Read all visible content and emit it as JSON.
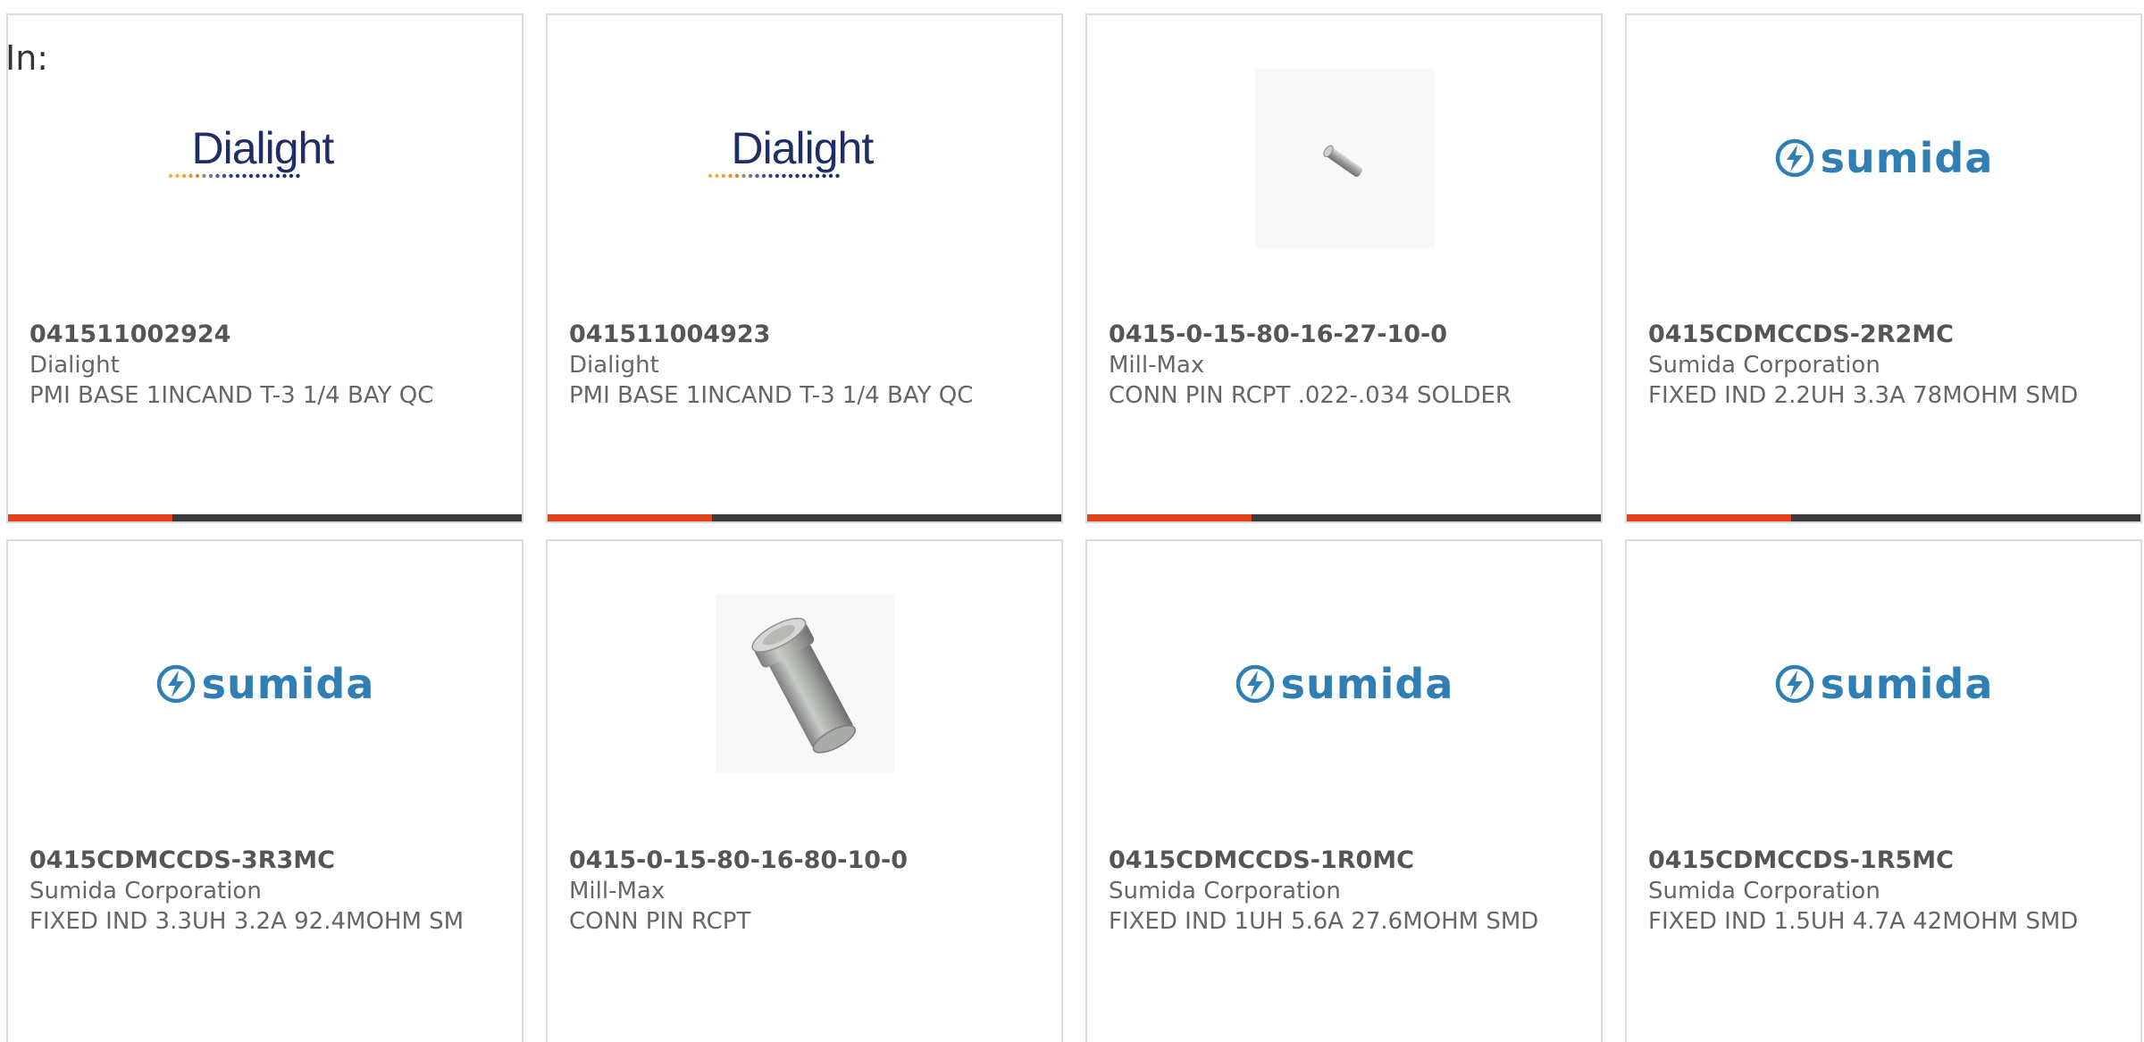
{
  "filter": {
    "label": "In:"
  },
  "products": [
    {
      "part_number": "041511002924",
      "manufacturer": "Dialight",
      "description": "PMI BASE 1INCAND T-3 1/4 BAY QC",
      "image": "dialight-logo",
      "logo_text": "Dialight",
      "progress": 0.32
    },
    {
      "part_number": "041511004923",
      "manufacturer": "Dialight",
      "description": "PMI BASE 1INCAND T-3 1/4 BAY QC",
      "image": "dialight-logo",
      "logo_text": "Dialight",
      "progress": 0.32
    },
    {
      "part_number": "0415-0-15-80-16-27-10-0",
      "manufacturer": "Mill-Max",
      "description": "CONN PIN RCPT .022-.034 SOLDER",
      "image": "small-pin-photo",
      "logo_text": "",
      "progress": 0.32
    },
    {
      "part_number": "0415CDMCCDS-2R2MC",
      "manufacturer": "Sumida Corporation",
      "description": "FIXED IND 2.2UH 3.3A 78MOHM SMD",
      "image": "sumida-logo",
      "logo_text": "sumida",
      "progress": 0.32
    },
    {
      "part_number": "0415CDMCCDS-3R3MC",
      "manufacturer": "Sumida Corporation",
      "description": "FIXED IND 3.3UH 3.2A 92.4MOHM SM",
      "image": "sumida-logo",
      "logo_text": "sumida",
      "progress": null
    },
    {
      "part_number": "0415-0-15-80-16-80-10-0",
      "manufacturer": "Mill-Max",
      "description": "CONN PIN RCPT",
      "image": "large-pin-photo",
      "logo_text": "",
      "progress": null
    },
    {
      "part_number": "0415CDMCCDS-1R0MC",
      "manufacturer": "Sumida Corporation",
      "description": "FIXED IND 1UH 5.6A 27.6MOHM SMD",
      "image": "sumida-logo",
      "logo_text": "sumida",
      "progress": null
    },
    {
      "part_number": "0415CDMCCDS-1R5MC",
      "manufacturer": "Sumida Corporation",
      "description": "FIXED IND 1.5UH 4.7A 42MOHM SMD",
      "image": "sumida-logo",
      "logo_text": "sumida",
      "progress": null
    }
  ],
  "colors": {
    "accent": "#e2411f",
    "track": "#3a3a3a",
    "border": "#dcdcdc",
    "dialight_blue": "#1f2f66",
    "sumida_blue": "#2f7fb4"
  }
}
